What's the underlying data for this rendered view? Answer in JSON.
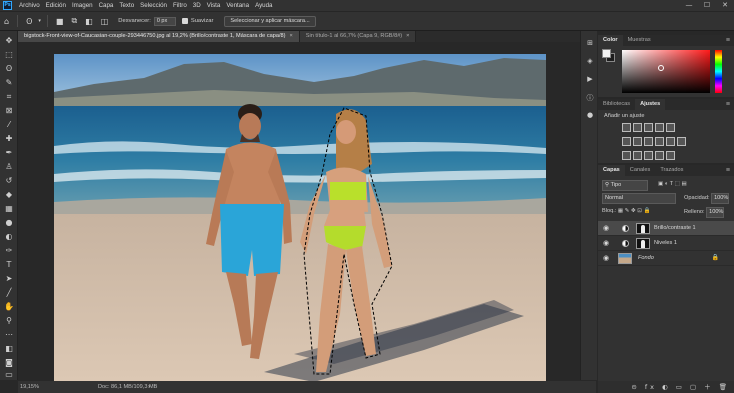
{
  "menu": {
    "logo": "Ps",
    "items": [
      "Archivo",
      "Edición",
      "Imagen",
      "Capa",
      "Texto",
      "Selección",
      "Filtro",
      "3D",
      "Vista",
      "Ventana",
      "Ayuda"
    ]
  },
  "window_controls": {
    "minimize": "—",
    "maximize": "☐",
    "close": "✕"
  },
  "options": {
    "feather_label": "Desvanecer:",
    "feather_value": "0 px",
    "antialias_label": "Suavizar",
    "select_mask_button": "Seleccionar y aplicar máscara..."
  },
  "tabs": [
    {
      "label": "bigstock-Front-view-of-Caucasian-couple-293446750.jpg al 19,2% (Brillo/contraste 1, Máscara de capa/8)",
      "close": "×"
    },
    {
      "label": "Sin título-1 al 66,7% (Capa 9, RGB/8#)",
      "close": "×"
    }
  ],
  "status": {
    "zoom": "19,15%",
    "doc": "Doc: 86,1 MB/109,3 MB",
    "arrow": "›"
  },
  "color_panel": {
    "tabs": [
      "Color",
      "Muestras"
    ],
    "foreground": "#f2f2f2",
    "background": "#1d1d1d",
    "hue": "#ff0000"
  },
  "adjust_panel": {
    "tabs": [
      "Bibliotecas",
      "Ajustes"
    ],
    "title": "Añadir un ajuste"
  },
  "layers_panel": {
    "tabs": [
      "Capas",
      "Canales",
      "Trazados"
    ],
    "filter": "Tipo",
    "blend_mode": "Normal",
    "opacity_label": "Opacidad:",
    "opacity_value": "100%",
    "lock_label": "Bloq.:",
    "fill_label": "Relleno:",
    "fill_value": "100%",
    "layers": [
      {
        "name": "Brillo/contraste 1",
        "type": "adjustment",
        "active": true
      },
      {
        "name": "Niveles 1",
        "type": "adjustment",
        "active": false
      },
      {
        "name": "Fondo",
        "type": "image",
        "active": false
      }
    ],
    "bottom_icons": "⊝ fx ◐ ▭ ▢ ＋ 🗑"
  }
}
